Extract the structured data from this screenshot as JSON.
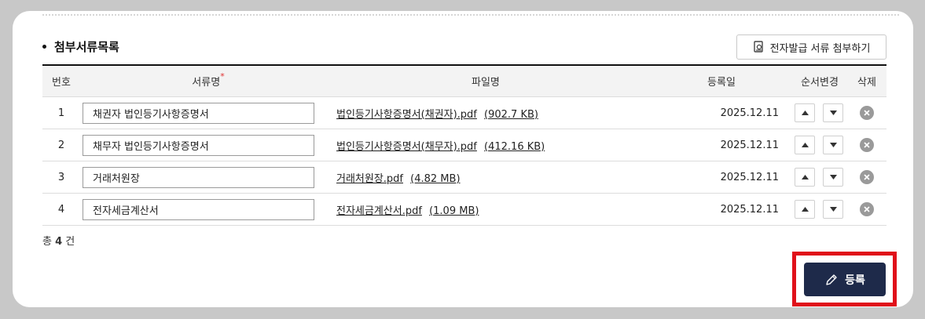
{
  "section": {
    "title": "첨부서류목록",
    "attach_button_label": "전자발급 서류 첨부하기"
  },
  "table": {
    "headers": {
      "no": "번호",
      "name": "서류명",
      "name_required_mark": "*",
      "file": "파일명",
      "date": "등록일",
      "order": "순서변경",
      "delete": "삭제"
    },
    "rows": [
      {
        "no": "1",
        "name": "채권자 법인등기사항증명서",
        "file": "법인등기사항증명서(채권자).pdf",
        "size": "(902.7 KB)",
        "date": "2025.12.11"
      },
      {
        "no": "2",
        "name": "채무자 법인등기사항증명서",
        "file": "법인등기사항증명서(채무자).pdf",
        "size": "(412.16 KB)",
        "date": "2025.12.11"
      },
      {
        "no": "3",
        "name": "거래처원장",
        "file": "거래처원장.pdf",
        "size": "(4.82 MB)",
        "date": "2025.12.11"
      },
      {
        "no": "4",
        "name": "전자세금계산서",
        "file": "전자세금계산서.pdf",
        "size": "(1.09 MB)",
        "date": "2025.12.11"
      }
    ]
  },
  "total": {
    "prefix": "총",
    "count": "4",
    "suffix": "건"
  },
  "submit_button_label": "등록",
  "icons": {
    "attach": "document-attach-icon",
    "up": "arrow-up-icon",
    "down": "arrow-down-icon",
    "delete": "close-circle-icon",
    "submit": "pencil-icon"
  },
  "colors": {
    "submit_bg": "#1e2a4a",
    "highlight": "#e0101a",
    "required": "#e03030"
  }
}
